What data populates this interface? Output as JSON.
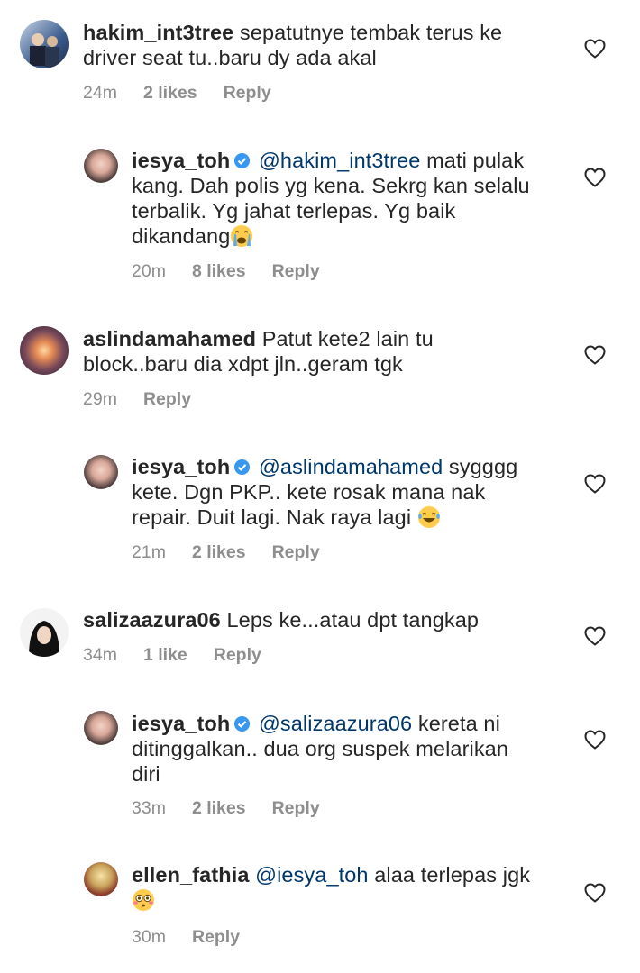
{
  "comments": [
    {
      "username": "hakim_int3tree",
      "text": "sepatutnye tembak terus ke driver seat tu..baru dy ada akal",
      "lines": [
        "sepatutnye tembak terus ke",
        "driver seat tu..baru dy ada akal"
      ],
      "time": "24m",
      "likes": "2 likes",
      "reply": "Reply"
    },
    {
      "username": "iesya_toh",
      "mention": "@hakim_int3tree",
      "lines": [
        "mati pulak",
        "kang. Dah polis yg kena. Sekrg kan selalu",
        "terbalik. Yg jahat terlepas. Yg baik",
        "dikandang"
      ],
      "emoji": "crying-face",
      "time": "20m",
      "likes": "8 likes",
      "reply": "Reply"
    },
    {
      "username": "aslindamahamed",
      "lines": [
        "Patut kete2 lain tu",
        "block..baru dia xdpt jln..geram tgk"
      ],
      "time": "29m",
      "likes": "",
      "reply": "Reply"
    },
    {
      "username": "iesya_toh",
      "mention": "@aslindamahamed",
      "lines": [
        "sygggg",
        "kete. Dgn PKP.. kete rosak mana nak",
        "repair. Duit lagi. Nak raya lagi"
      ],
      "emoji": "tears-of-joy",
      "time": "21m",
      "likes": "2 likes",
      "reply": "Reply"
    },
    {
      "username": "salizaazura06",
      "lines": [
        "Leps ke...atau dpt tangkap"
      ],
      "time": "34m",
      "likes": "1 like",
      "reply": "Reply"
    },
    {
      "username": "iesya_toh",
      "mention": "@salizaazura06",
      "lines": [
        "kereta ni",
        "ditinggalkan.. dua org suspek melarikan",
        "diri"
      ],
      "time": "33m",
      "likes": "2 likes",
      "reply": "Reply"
    },
    {
      "username": "ellen_fathia",
      "mention": "@iesya_toh",
      "lines": [
        "alaa terlepas jgk"
      ],
      "emoji": "flushed-face",
      "time": "30m",
      "likes": "",
      "reply": "Reply"
    }
  ],
  "colors": {
    "text": "#262626",
    "meta": "#8e8e8e",
    "mention": "#00376b",
    "verified": "#3897f0"
  }
}
